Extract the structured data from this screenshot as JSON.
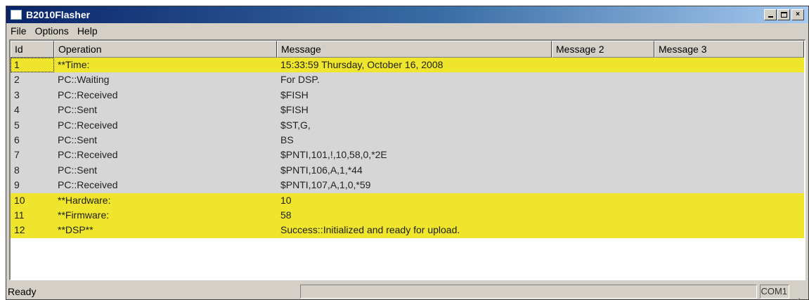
{
  "window": {
    "title": "B2010Flasher"
  },
  "controls": {
    "minimize": "_",
    "maximize": "□",
    "close": "×"
  },
  "menu": {
    "items": [
      "File",
      "Options",
      "Help"
    ]
  },
  "list": {
    "columns": [
      "Id",
      "Operation",
      "Message",
      "Message 2",
      "Message 3"
    ],
    "rows": [
      {
        "id": "1",
        "op": "**Time:",
        "msg": "15:33:59  Thursday, October 16, 2008",
        "highlight": true
      },
      {
        "id": "2",
        "op": "PC::Waiting",
        "msg": "For DSP.",
        "highlight": false
      },
      {
        "id": "3",
        "op": "PC::Received",
        "msg": "$FISH",
        "highlight": false
      },
      {
        "id": "4",
        "op": "PC::Sent",
        "msg": "$FISH",
        "highlight": false
      },
      {
        "id": "5",
        "op": "PC::Received",
        "msg": "$ST,G,",
        "highlight": false
      },
      {
        "id": "6",
        "op": "PC::Sent",
        "msg": "BS",
        "highlight": false
      },
      {
        "id": "7",
        "op": "PC::Received",
        "msg": "$PNTI,101,!,10,58,0,*2E",
        "highlight": false
      },
      {
        "id": "8",
        "op": "PC::Sent",
        "msg": "$PNTI,106,A,1,*44",
        "highlight": false
      },
      {
        "id": "9",
        "op": "PC::Received",
        "msg": "$PNTI,107,A,1,0,*59",
        "highlight": false
      },
      {
        "id": "10",
        "op": "**Hardware:",
        "msg": "10",
        "highlight": true
      },
      {
        "id": "11",
        "op": "**Firmware:",
        "msg": "58",
        "highlight": true
      },
      {
        "id": "12",
        "op": "**DSP**",
        "msg": "Success::Initialized and ready for upload.",
        "highlight": true
      }
    ]
  },
  "status": {
    "text": "Ready",
    "port": "COM1"
  },
  "colors": {
    "highlight": "#eee52c",
    "row_bg": "#d6d6d6",
    "titlebar": "#0a246a"
  }
}
